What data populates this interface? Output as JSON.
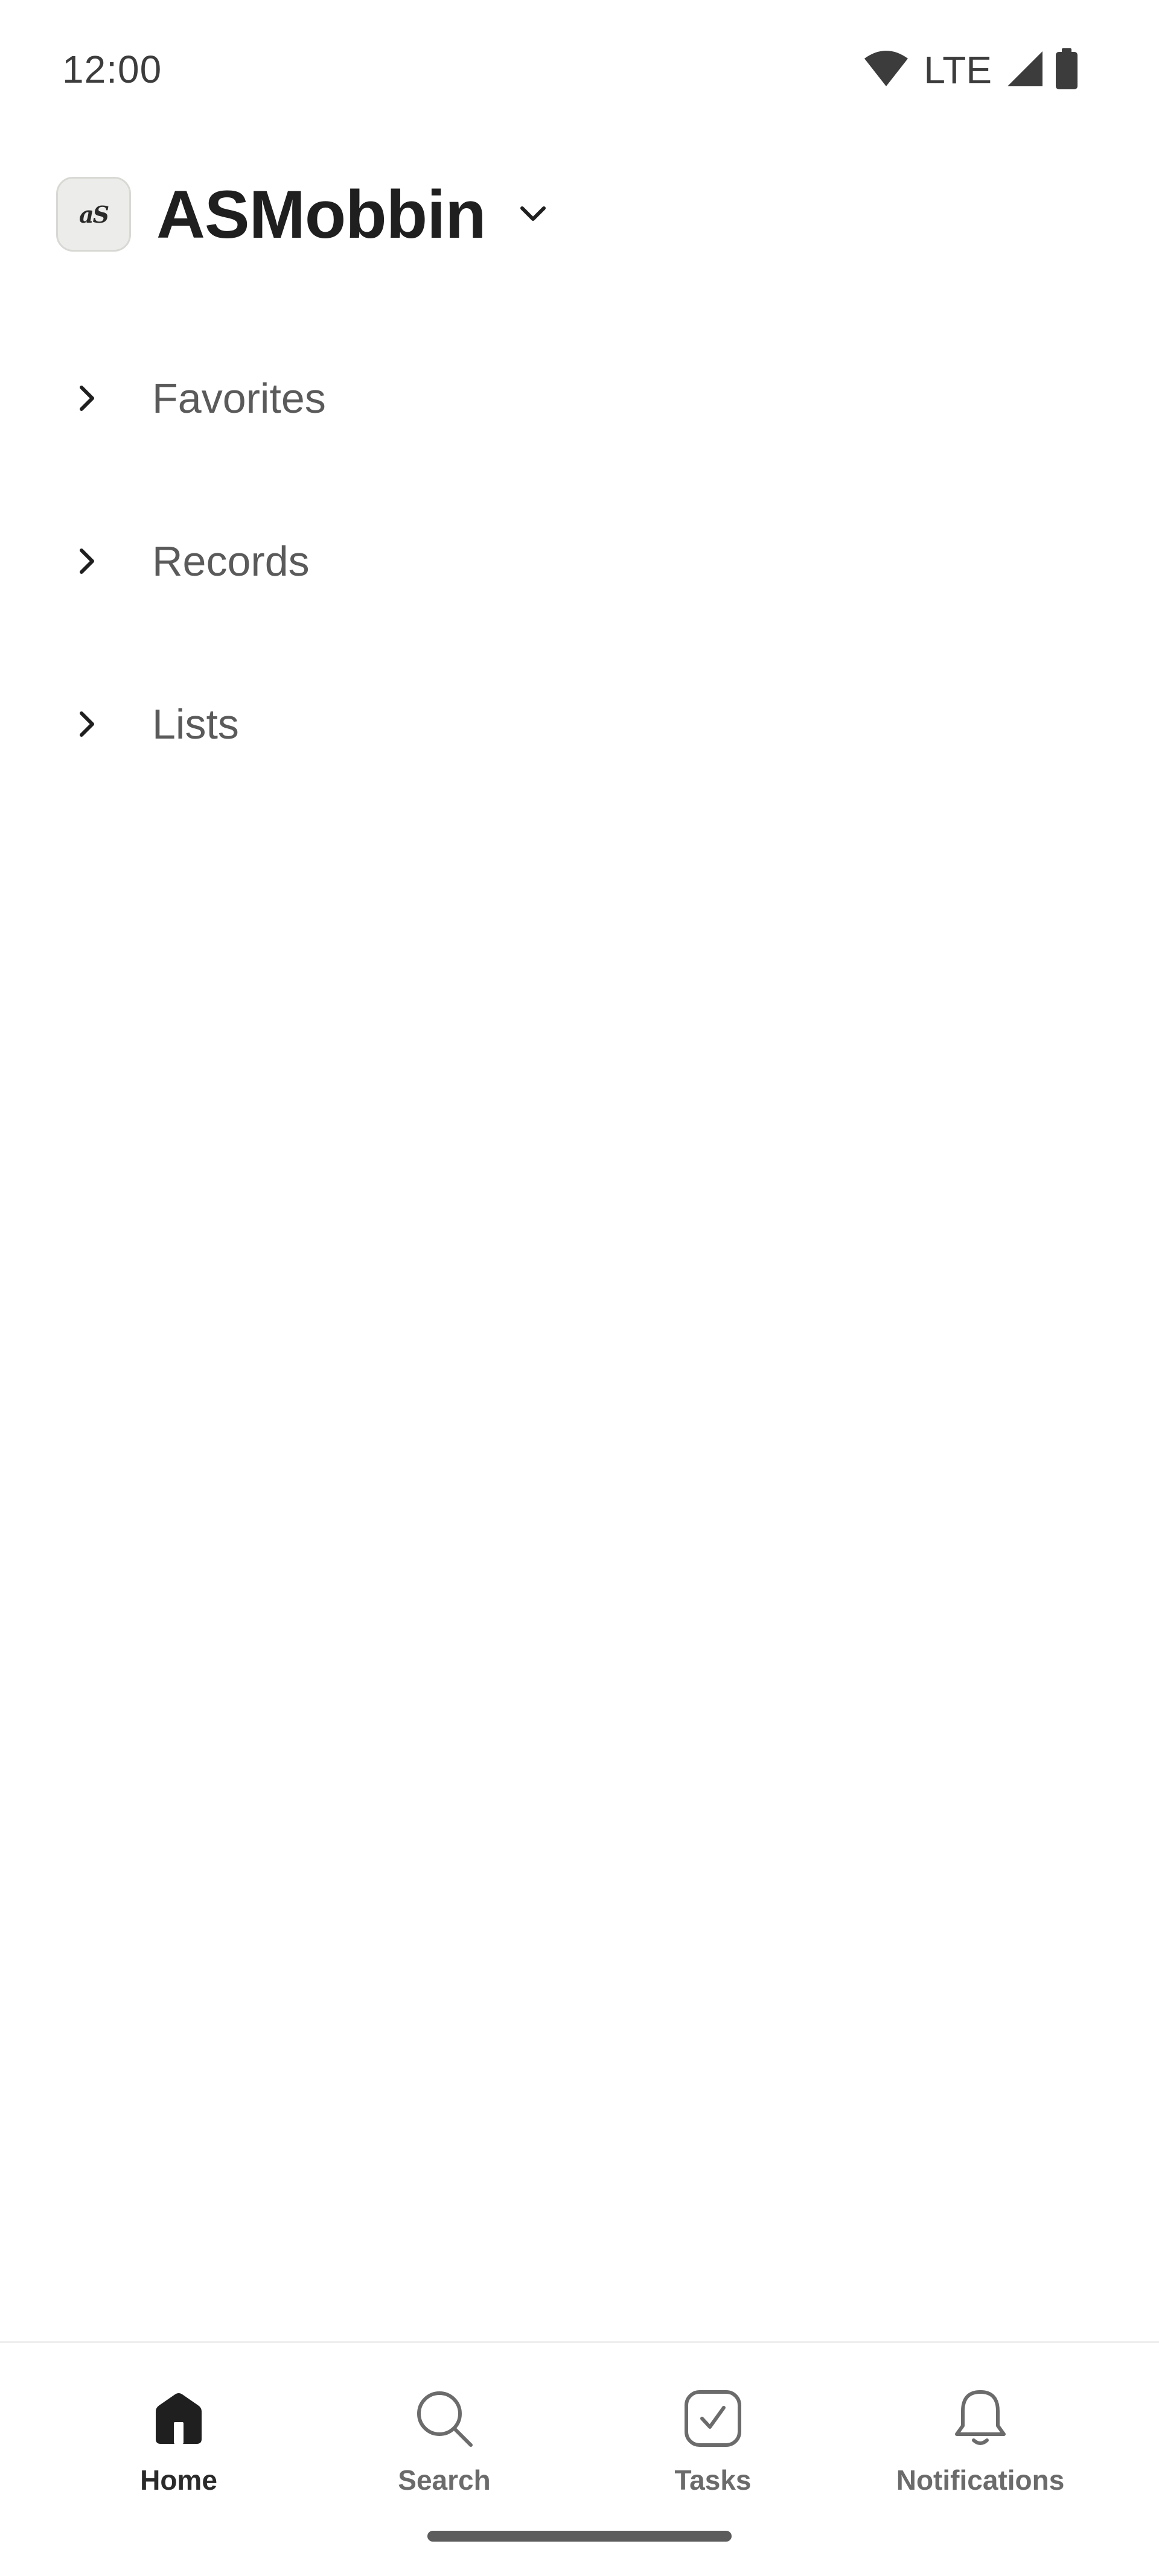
{
  "status_bar": {
    "time": "12:00",
    "network": "LTE",
    "icons": [
      "wifi-icon",
      "cellular-signal-icon",
      "battery-icon"
    ]
  },
  "header": {
    "workspace_name": "ASMobbin",
    "avatar_icon": "workspace-logo",
    "avatar_text": "aS"
  },
  "sections": [
    {
      "label": "Favorites",
      "icon": "chevron-right-icon",
      "expanded": false
    },
    {
      "label": "Records",
      "icon": "chevron-right-icon",
      "expanded": false
    },
    {
      "label": "Lists",
      "icon": "chevron-right-icon",
      "expanded": false
    }
  ],
  "bottom_nav": {
    "items": [
      {
        "label": "Home",
        "icon": "home-icon",
        "active": true
      },
      {
        "label": "Search",
        "icon": "search-icon",
        "active": false
      },
      {
        "label": "Tasks",
        "icon": "tasks-icon",
        "active": false
      },
      {
        "label": "Notifications",
        "icon": "bell-icon",
        "active": false
      }
    ]
  },
  "colors": {
    "background": "#ffffff",
    "text_primary": "#1f1f1f",
    "text_secondary": "#5a5a5a",
    "nav_inactive": "#6b6b6b"
  }
}
